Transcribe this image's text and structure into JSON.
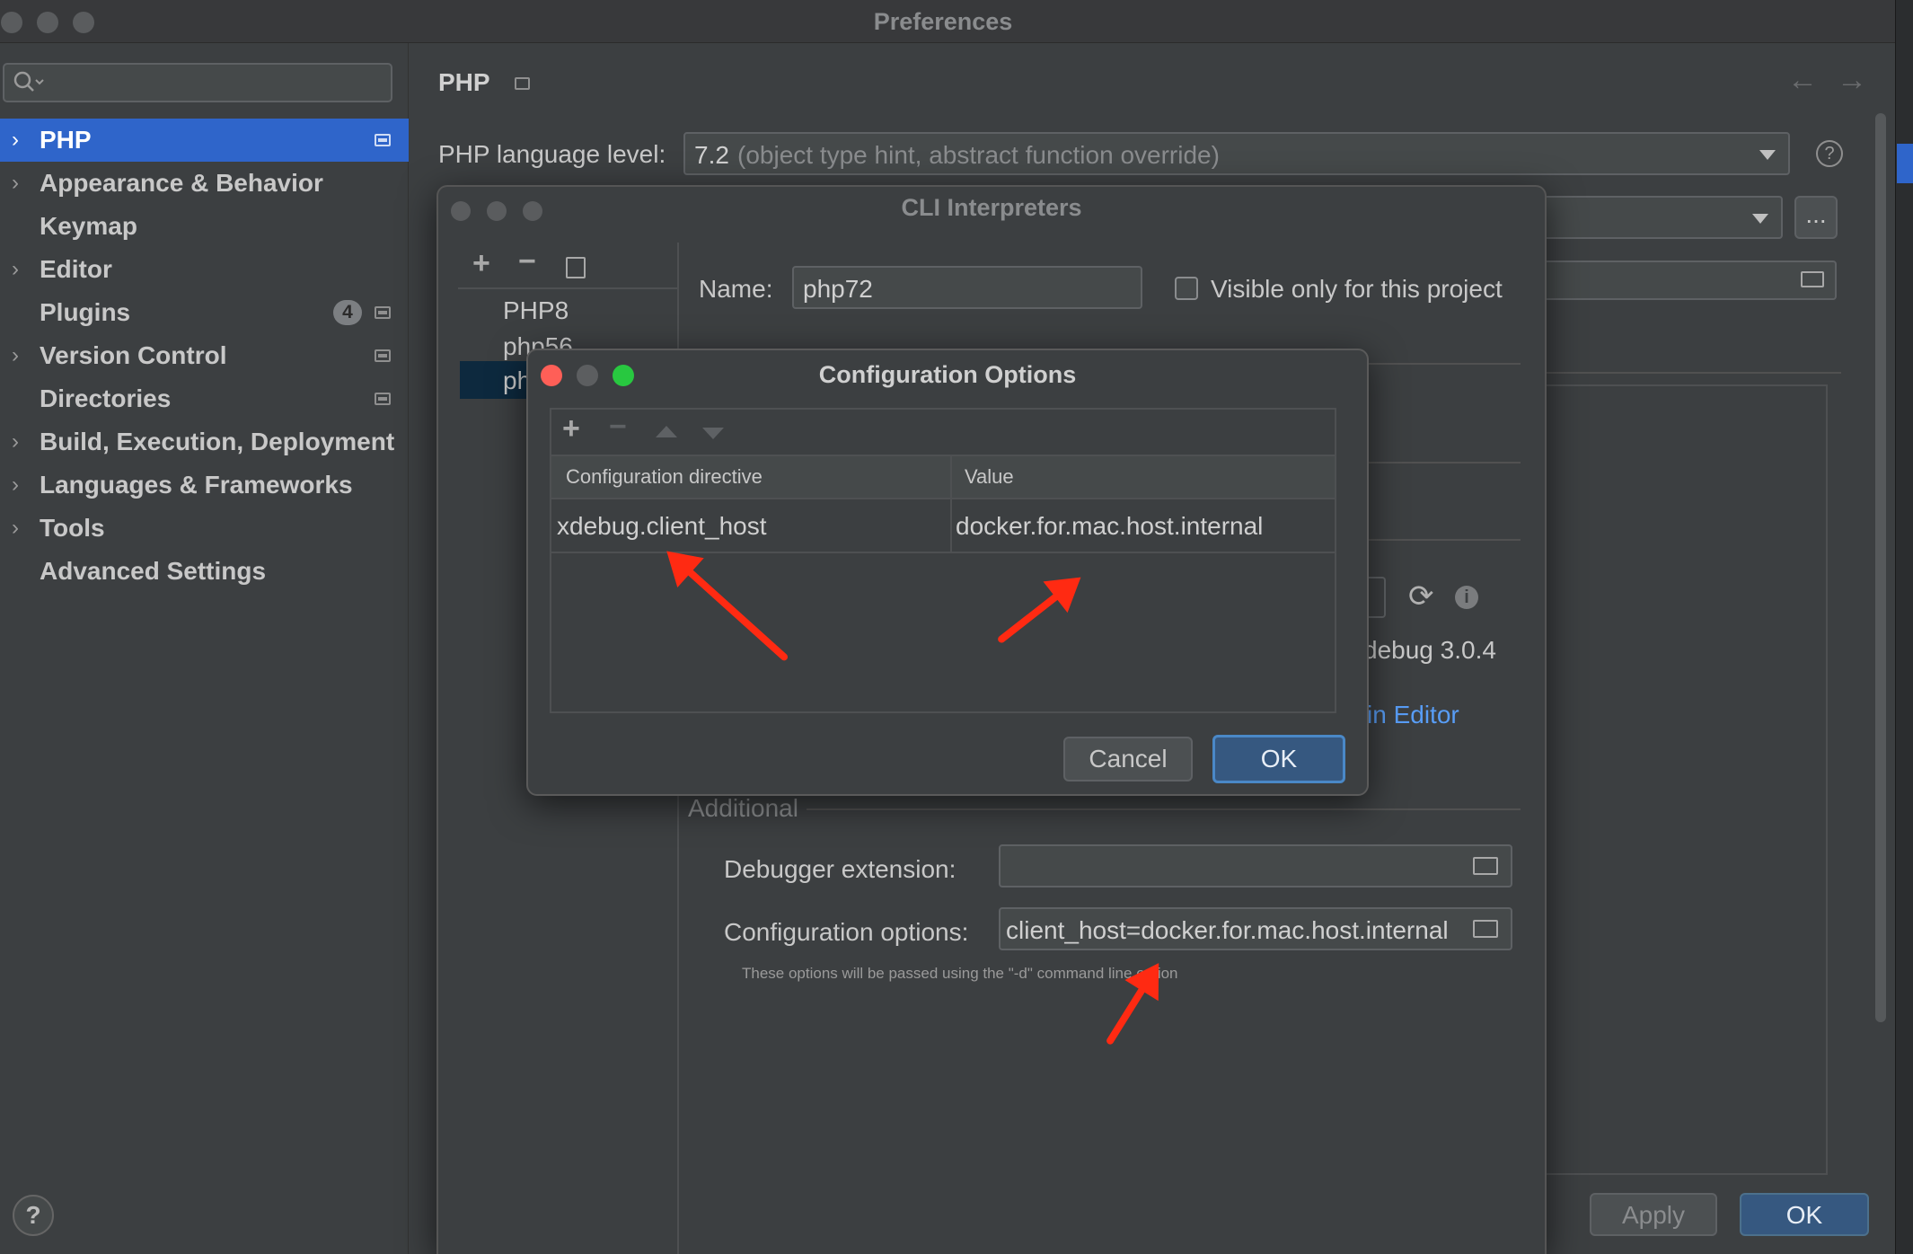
{
  "window": {
    "title": "Preferences"
  },
  "sidebar": {
    "search_placeholder": "",
    "items": [
      {
        "label": "PHP",
        "expandable": true,
        "selected": true,
        "pinned": true
      },
      {
        "label": "Appearance & Behavior",
        "expandable": true
      },
      {
        "label": "Keymap",
        "expandable": false
      },
      {
        "label": "Editor",
        "expandable": true
      },
      {
        "label": "Plugins",
        "expandable": false,
        "badge": "4",
        "pinned": true
      },
      {
        "label": "Version Control",
        "expandable": true,
        "pinned": true
      },
      {
        "label": "Directories",
        "expandable": false,
        "pinned": true
      },
      {
        "label": "Build, Execution, Deployment",
        "expandable": true
      },
      {
        "label": "Languages & Frameworks",
        "expandable": true
      },
      {
        "label": "Tools",
        "expandable": true
      },
      {
        "label": "Advanced Settings",
        "expandable": false
      }
    ],
    "help_label": "?"
  },
  "main": {
    "title": "PHP",
    "language_level_label": "PHP language level:",
    "language_level_version": "7.2",
    "language_level_desc": "(object type hint, abstract function override)",
    "browse_label": "...",
    "apply_label": "Apply",
    "ok_label": "OK"
  },
  "cli_dialog": {
    "title": "CLI Interpreters",
    "interpreters": [
      "PHP8",
      "php56",
      "ph"
    ],
    "name_label": "Name:",
    "name_value": "php72",
    "visible_only_label": "Visible only for this project",
    "debugger_version_partial": "debug 3.0.4",
    "open_in_editor_partial": "in Editor",
    "additional_label": "Additional",
    "debugger_extension_label": "Debugger extension:",
    "debugger_extension_value": "",
    "config_options_label": "Configuration options:",
    "config_options_value": "client_host=docker.for.mac.host.internal",
    "hint": "These options will be passed using the \"-d\" command line option"
  },
  "config_dialog": {
    "title": "Configuration Options",
    "columns": [
      "Configuration directive",
      "Value"
    ],
    "rows": [
      {
        "directive": "xdebug.client_host",
        "value": "docker.for.mac.host.internal"
      }
    ],
    "cancel_label": "Cancel",
    "ok_label": "OK"
  },
  "colors": {
    "accent": "#2f65ca",
    "annotation_arrow": "#ff2a12",
    "link": "#589df6",
    "close": "#ff5f57",
    "minimize": "#5c5e60",
    "zoom": "#28c840"
  }
}
